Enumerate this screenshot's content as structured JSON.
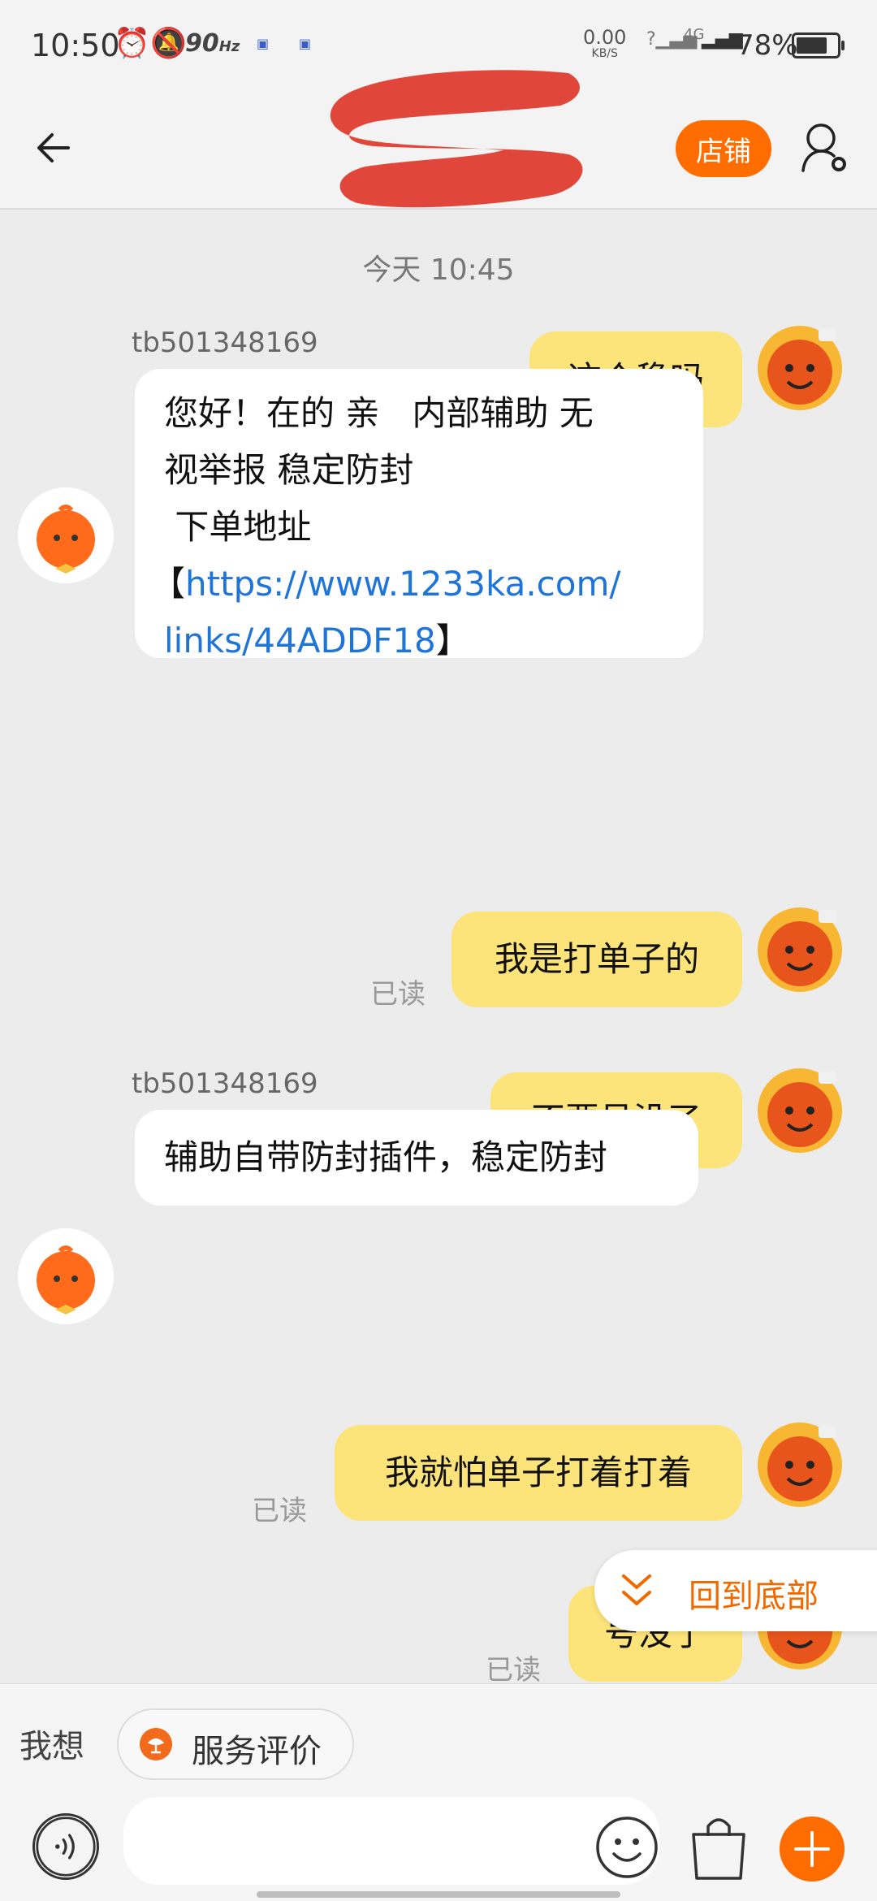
{
  "status_bar": {
    "time": "10:50",
    "refresh_rate": "90",
    "refresh_unit": "Hz",
    "net_speed_value": "0.00",
    "net_speed_unit": "KB/S",
    "network_type": "4G",
    "battery": "78%",
    "battery_level": 0.78
  },
  "header": {
    "back_icon": "back-arrow-icon",
    "title_redacted": true,
    "shop_button": "店铺",
    "user_settings_icon": "user-settings-icon"
  },
  "chat": {
    "timestamp": "今天 10:45",
    "read_label": "已读",
    "messages": [
      {
        "from": "me",
        "text": "这个稳吗",
        "read": "已读"
      },
      {
        "from": "other",
        "sender": "tb501348169",
        "lines": [
          "您好！在的 亲   内部辅助 无",
          "视举报 稳定防封",
          " 下单地址"
        ],
        "link_prefix": "【",
        "link": "https://www.1233ka.com/links/44ADDF18",
        "link_line1": "https://www.1233ka.com/",
        "link_line2": "links/44ADDF18",
        "link_suffix": "】"
      },
      {
        "from": "me",
        "text": "我是打单子的",
        "read": "已读"
      },
      {
        "from": "me",
        "text": "不要号没了",
        "read": "已读"
      },
      {
        "from": "other",
        "sender": "tb501348169",
        "text": "辅助自带防封插件，稳定防封"
      },
      {
        "from": "me",
        "text": "我就怕单子打着打着",
        "read": "已读"
      },
      {
        "from": "me",
        "text": "号没了",
        "read": "已读"
      }
    ],
    "scroll_to_bottom": "回到底部"
  },
  "quick_actions": {
    "prefix": "我想",
    "chip_label": "服务评价"
  },
  "input_bar": {
    "voice_icon": "voice-icon",
    "emoji_icon": "emoji-icon",
    "bag_icon": "shopping-bag-icon",
    "plus_icon": "plus-icon"
  },
  "colors": {
    "accent": "#ff6d00",
    "my_bubble": "#fde47a",
    "their_bubble": "#ffffff",
    "link": "#1f74d8",
    "redaction": "#e0463a"
  }
}
